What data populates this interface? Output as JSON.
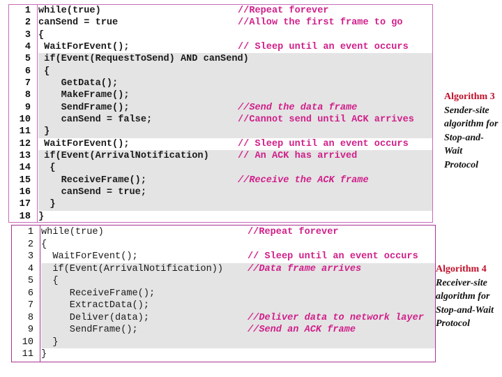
{
  "sender_algorithm": {
    "lines": [
      {
        "n": "1",
        "code": "while(true)",
        "comment": "//Repeat forever",
        "italic": false,
        "hl": false
      },
      {
        "n": "2",
        "code": "canSend = true",
        "comment": "//Allow the first frame to go",
        "italic": false,
        "hl": false
      },
      {
        "n": "3",
        "code": "{",
        "comment": "",
        "italic": false,
        "hl": false
      },
      {
        "n": "4",
        "code": " WaitForEvent();",
        "comment": "// Sleep until an event occurs",
        "italic": false,
        "hl": false
      },
      {
        "n": "5",
        "code": " if(Event(RequestToSend) AND canSend)",
        "comment": "",
        "italic": false,
        "hl": true
      },
      {
        "n": "6",
        "code": " {",
        "comment": "",
        "italic": false,
        "hl": true
      },
      {
        "n": "7",
        "code": "    GetData();",
        "comment": "",
        "italic": false,
        "hl": true
      },
      {
        "n": "8",
        "code": "    MakeFrame();",
        "comment": "",
        "italic": false,
        "hl": true
      },
      {
        "n": "9",
        "code": "    SendFrame();",
        "comment": "//Send the data frame",
        "italic": true,
        "hl": true
      },
      {
        "n": "10",
        "code": "    canSend = false;",
        "comment": "//Cannot send until ACK arrives",
        "italic": false,
        "hl": true
      },
      {
        "n": "11",
        "code": " }",
        "comment": "",
        "italic": false,
        "hl": true
      },
      {
        "n": "12",
        "code": " WaitForEvent();",
        "comment": "// Sleep until an event occurs",
        "italic": false,
        "hl": false
      },
      {
        "n": "13",
        "code": " if(Event(ArrivalNotification)",
        "comment": "// An ACK has arrived",
        "italic": false,
        "hl": true
      },
      {
        "n": "14",
        "code": "  {",
        "comment": "",
        "italic": false,
        "hl": true
      },
      {
        "n": "15",
        "code": "    ReceiveFrame();",
        "comment": "//Receive the ACK frame",
        "italic": true,
        "hl": true
      },
      {
        "n": "16",
        "code": "    canSend = true;",
        "comment": "",
        "italic": false,
        "hl": true
      },
      {
        "n": "17",
        "code": "  }",
        "comment": "",
        "italic": false,
        "hl": true
      },
      {
        "n": "18",
        "code": "}",
        "comment": "",
        "italic": false,
        "hl": false
      }
    ],
    "caption_title": "Algorithm 3",
    "caption_lines": [
      "Sender-site",
      "algorithm for",
      "Stop-and-",
      "Wait",
      "Protocol"
    ]
  },
  "receiver_algorithm": {
    "lines": [
      {
        "n": "1",
        "code": "while(true)",
        "comment": "//Repeat forever",
        "italic": false,
        "hl": false
      },
      {
        "n": "2",
        "code": "{",
        "comment": "",
        "italic": false,
        "hl": false
      },
      {
        "n": "3",
        "code": "  WaitForEvent();",
        "comment": "// Sleep until an event occurs",
        "italic": false,
        "hl": false
      },
      {
        "n": "4",
        "code": "  if(Event(ArrivalNotification))",
        "comment": "//Data frame arrives",
        "italic": true,
        "hl": true
      },
      {
        "n": "5",
        "code": "  {",
        "comment": "",
        "italic": false,
        "hl": true
      },
      {
        "n": "6",
        "code": "     ReceiveFrame();",
        "comment": "",
        "italic": false,
        "hl": true
      },
      {
        "n": "7",
        "code": "     ExtractData();",
        "comment": "",
        "italic": false,
        "hl": true
      },
      {
        "n": "8",
        "code": "     Deliver(data);",
        "comment": "//Deliver data to network layer",
        "italic": true,
        "hl": true
      },
      {
        "n": "9",
        "code": "     SendFrame();",
        "comment": "//Send an ACK frame",
        "italic": true,
        "hl": true
      },
      {
        "n": "10",
        "code": "  }",
        "comment": "",
        "italic": false,
        "hl": true
      },
      {
        "n": "11",
        "code": "}",
        "comment": "",
        "italic": false,
        "hl": false
      }
    ],
    "caption_title": "Algorithm 4",
    "caption_lines": [
      "Receiver-site",
      "algorithm for",
      "Stop-and-Wait",
      "Protocol"
    ]
  },
  "colors": {
    "comment": "#d0208a",
    "caption_title": "#c0102a",
    "border": "#b03c9a",
    "highlight": "#e4e4e4"
  }
}
